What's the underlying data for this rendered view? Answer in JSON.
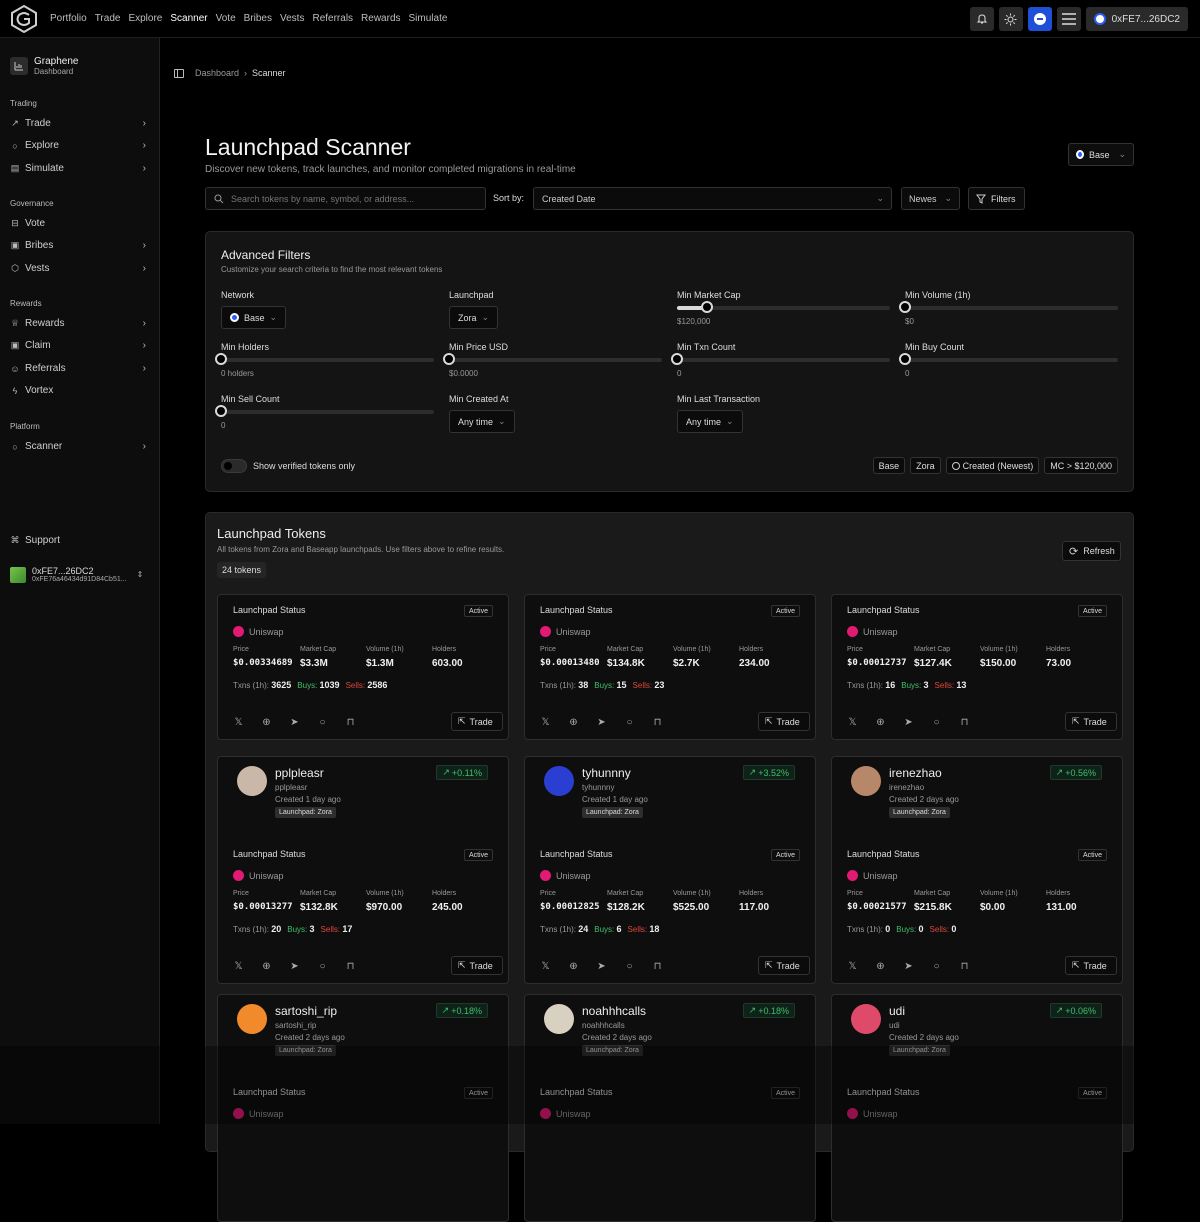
{
  "topnav": {
    "items": [
      "Portfolio",
      "Trade",
      "Explore",
      "Scanner",
      "Vote",
      "Bribes",
      "Vests",
      "Referrals",
      "Rewards",
      "Simulate"
    ],
    "wallet_label": "0xFE7...26DC2"
  },
  "sidebar": {
    "brand_name": "Graphene",
    "brand_sub": "Dashboard",
    "sections": {
      "trading": "Trading",
      "governance": "Governance",
      "rewards": "Rewards",
      "platform": "Platform"
    },
    "items": {
      "trade": "Trade",
      "explore": "Explore",
      "simulate": "Simulate",
      "vote": "Vote",
      "bribes": "Bribes",
      "vests": "Vests",
      "rewards": "Rewards",
      "claim": "Claim",
      "referrals": "Referrals",
      "vortex": "Vortex",
      "scanner": "Scanner",
      "support": "Support"
    },
    "account": {
      "name": "0xFE7...26DC2",
      "address": "0xFE76a46434d91D84Cb51..."
    }
  },
  "breadcrumb": {
    "root": "Dashboard",
    "current": "Scanner"
  },
  "header": {
    "title": "Launchpad Scanner",
    "subtitle": "Discover new tokens, track launches, and monitor completed migrations in real-time",
    "network": "Base"
  },
  "toolbar": {
    "search_placeholder": "Search tokens by name, symbol, or address...",
    "sort_label": "Sort by:",
    "sort_value": "Created Date",
    "order_value": "Newes",
    "filters_label": "Filters"
  },
  "advanced": {
    "title": "Advanced Filters",
    "subtitle": "Customize your search criteria to find the most relevant tokens",
    "network_label": "Network",
    "network_value": "Base",
    "launchpad_label": "Launchpad",
    "launchpad_value": "Zora",
    "min_mcap_label": "Min Market Cap",
    "min_mcap_value": "$120,000",
    "min_mcap_fraction": 0.14,
    "min_volume_label": "Min Volume (1h)",
    "min_volume_value": "$0",
    "min_holders_label": "Min Holders",
    "min_holders_value": "0 holders",
    "min_price_label": "Min Price USD",
    "min_price_value": "$0.0000",
    "min_txn_label": "Min Txn Count",
    "min_txn_value": "0",
    "min_buy_label": "Min Buy Count",
    "min_buy_value": "0",
    "min_sell_label": "Min Sell Count",
    "min_sell_value": "0",
    "min_created_label": "Min Created At",
    "min_created_value": "Any time",
    "min_last_tx_label": "Min Last Transaction",
    "min_last_tx_value": "Any time",
    "verified_label": "Show verified tokens only",
    "chips": [
      "Base",
      "Zora",
      "Created (Newest)",
      "MC > $120,000"
    ]
  },
  "tokens": {
    "title": "Launchpad Tokens",
    "subtitle": "All tokens from Zora and Baseapp launchpads. Use filters above to refine results.",
    "count": "24 tokens",
    "refresh_label": "Refresh",
    "labels": {
      "status": "Launchpad Status",
      "active": "Active",
      "dex": "Uniswap",
      "price": "Price",
      "mcap": "Market Cap",
      "volume": "Volume (1h)",
      "holders": "Holders",
      "txns": "Txns (1h):",
      "buys": "Buys:",
      "sells": "Sells:",
      "trade": "Trade"
    },
    "cards": [
      {
        "price": "$0.00334689",
        "mcap": "$3.3M",
        "volume": "$1.3M",
        "holders": "603.00",
        "txns": "3625",
        "buys": "1039",
        "sells": "2586"
      },
      {
        "price": "$0.00013480",
        "mcap": "$134.8K",
        "volume": "$2.7K",
        "holders": "234.00",
        "txns": "38",
        "buys": "15",
        "sells": "23"
      },
      {
        "price": "$0.00012737",
        "mcap": "$127.4K",
        "volume": "$150.00",
        "holders": "73.00",
        "txns": "16",
        "buys": "3",
        "sells": "13"
      },
      {
        "name": "pplpleasr",
        "handle": "pplpleasr",
        "created": "Created 1 day ago",
        "tag": "Launchpad: Zora",
        "change": "+0.11%",
        "price": "$0.00013277",
        "mcap": "$132.8K",
        "volume": "$970.00",
        "holders": "245.00",
        "txns": "20",
        "buys": "3",
        "sells": "17",
        "avatar_color": "#c9b8a8"
      },
      {
        "name": "tyhunnny",
        "handle": "tyhunnny",
        "created": "Created 1 day ago",
        "tag": "Launchpad: Zora",
        "change": "+3.52%",
        "price": "$0.00012825",
        "mcap": "$128.2K",
        "volume": "$525.00",
        "holders": "117.00",
        "txns": "24",
        "buys": "6",
        "sells": "18",
        "avatar_color": "#2a3fd1"
      },
      {
        "name": "irenezhao",
        "handle": "irenezhao",
        "created": "Created 2 days ago",
        "tag": "Launchpad: Zora",
        "change": "+0.56%",
        "price": "$0.00021577",
        "mcap": "$215.8K",
        "volume": "$0.00",
        "holders": "131.00",
        "txns": "0",
        "buys": "0",
        "sells": "0",
        "avatar_color": "#b7876a"
      },
      {
        "name": "sartoshi_rip",
        "handle": "sartoshi_rip",
        "created": "Created 2 days ago",
        "tag": "Launchpad: Zora",
        "change": "+0.18%",
        "avatar_color": "#f08a2a"
      },
      {
        "name": "noahhhcalls",
        "handle": "noahhhcalls",
        "created": "Created 2 days ago",
        "tag": "Launchpad: Zora",
        "change": "+0.18%",
        "avatar_color": "#d8d0c0"
      },
      {
        "name": "udi",
        "handle": "udi",
        "created": "Created 2 days ago",
        "tag": "Launchpad: Zora",
        "change": "+0.06%",
        "avatar_color": "#e04a6a"
      }
    ]
  }
}
